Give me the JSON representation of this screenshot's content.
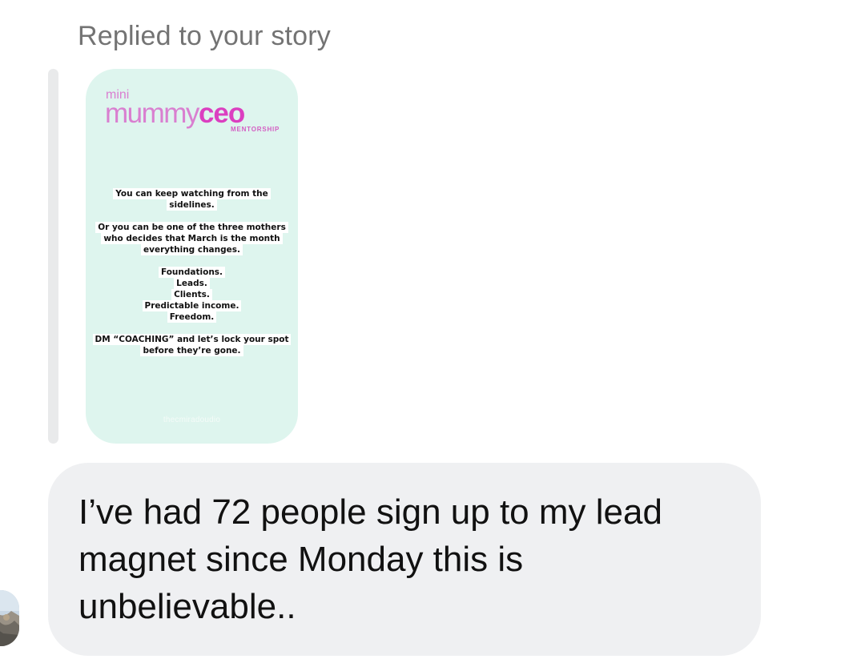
{
  "reply_label": "Replied to your story",
  "story": {
    "logo": {
      "mini": "mini",
      "mummy": "mummy",
      "ceo": "ceo",
      "subtitle": "MENTORSHIP"
    },
    "paragraphs": [
      "You can keep watching from the sidelines.",
      "Or you can be one of the three mothers who decides that March is the month everything changes.",
      [
        "Foundations.",
        "Leads.",
        "Clients.",
        "Predictable income.",
        "Freedom."
      ],
      "DM “COACHING” and let’s lock your spot before they’re gone."
    ],
    "watermark": "thecmiradoudio",
    "colors": {
      "background": "#def5ee",
      "brand_pink": "#db3fc0"
    }
  },
  "message": {
    "text": "I’ve had 72 people sign up to my lead magnet since Monday this is unbelievable.."
  },
  "avatar": {
    "icon": "sender-avatar"
  }
}
